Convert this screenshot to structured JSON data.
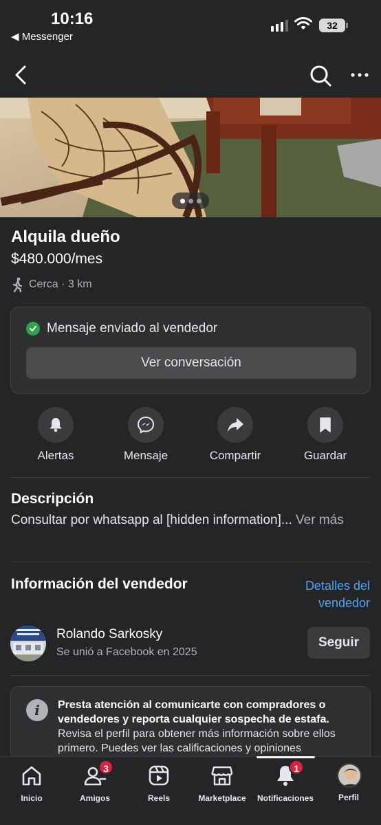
{
  "status_bar": {
    "time": "10:16",
    "back_app": "◀ Messenger",
    "battery": "32"
  },
  "listing": {
    "title": "Alquila dueño",
    "price": "$480.000/mes",
    "location": "Cerca · 3 km"
  },
  "message_card": {
    "status": "Mensaje enviado al vendedor",
    "button": "Ver conversación"
  },
  "actions": [
    {
      "label": "Alertas",
      "icon": "bell-icon"
    },
    {
      "label": "Mensaje",
      "icon": "messenger-icon"
    },
    {
      "label": "Compartir",
      "icon": "share-icon"
    },
    {
      "label": "Guardar",
      "icon": "bookmark-icon"
    }
  ],
  "description": {
    "title": "Descripción",
    "text": "Consultar por whatsapp al [hidden information]...",
    "see_more": "Ver más"
  },
  "seller": {
    "section_title": "Información del vendedor",
    "details_link": "Detalles del vendedor",
    "name": "Rolando Sarkosky",
    "joined": "Se unió a Facebook en 2025",
    "follow": "Seguir"
  },
  "warning": {
    "bold": "Presta atención al comunicarte con compradores o vendedores y reporta cualquier sospecha de estafa.",
    "text": "Revisa el perfil para obtener más información sobre ellos primero. Puedes ver las calificaciones y opiniones"
  },
  "tabbar": {
    "items": [
      {
        "label": "Inicio",
        "icon": "home-icon"
      },
      {
        "label": "Amigos",
        "icon": "friends-icon",
        "badge": "3"
      },
      {
        "label": "Reels",
        "icon": "reels-icon"
      },
      {
        "label": "Marketplace",
        "icon": "marketplace-icon"
      },
      {
        "label": "Notificaciones",
        "icon": "bell-icon",
        "badge": "1"
      },
      {
        "label": "Perfil",
        "icon": "profile-avatar"
      }
    ]
  },
  "colors": {
    "background": "#242526",
    "card": "#2e2f30",
    "link": "#4ea5f5",
    "success": "#31a24c",
    "badge": "#e41e3f"
  }
}
